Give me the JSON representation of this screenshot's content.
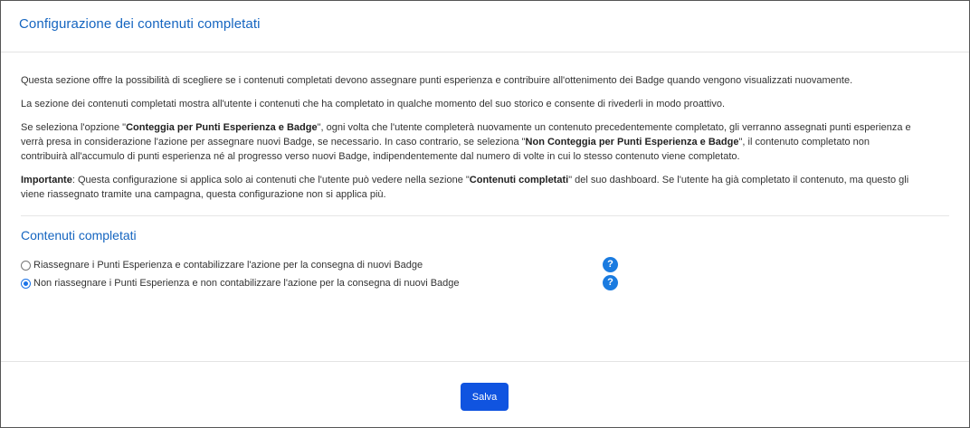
{
  "header": {
    "title": "Configurazione dei contenuti completati"
  },
  "intro": {
    "p1": "Questa sezione offre la possibilità di scegliere se i contenuti completati devono assegnare punti esperienza e contribuire all'ottenimento dei Badge quando vengono visualizzati nuovamente.",
    "p2": "La sezione dei contenuti completati mostra all'utente i contenuti che ha completato in qualche momento del suo storico e consente di rivederli in modo proattivo.",
    "p3_a": "Se seleziona l'opzione \"",
    "p3_b1": "Conteggia per Punti Esperienza e Badge",
    "p3_c": "\", ogni volta che l'utente completerà nuovamente un contenuto precedentemente completato, gli verranno assegnati punti esperienza e verrà presa in considerazione l'azione per assegnare nuovi Badge, se necessario. In caso contrario, se seleziona \"",
    "p3_b2": "Non Conteggia per Punti Esperienza e Badge",
    "p3_d": "\", il contenuto completato non contribuirà all'accumulo di punti esperienza né al progresso verso nuovi Badge, indipendentemente dal numero di volte in cui lo stesso contenuto viene completato.",
    "p4_b1": "Importante",
    "p4_a": ": Questa configurazione si applica solo ai contenuti che l'utente può vedere nella sezione \"",
    "p4_b2": "Contenuti completati",
    "p4_c": "\" del suo dashboard. Se l'utente ha già completato il contenuto, ma questo gli viene riassegnato tramite una campagna, questa configurazione non si applica più."
  },
  "section": {
    "title": "Contenuti completati",
    "options": [
      {
        "label": "Riassegnare i Punti Esperienza e contabilizzare l'azione per la consegna di nuovi Badge",
        "checked": false
      },
      {
        "label": "Non riassegnare i Punti Esperienza e non contabilizzare l'azione per la consegna di nuovi Badge",
        "checked": true
      }
    ],
    "help_glyph": "?"
  },
  "footer": {
    "save_label": "Salva"
  },
  "colors": {
    "accent": "#1565c0",
    "button": "#1054e0",
    "help": "#1a7be0"
  }
}
